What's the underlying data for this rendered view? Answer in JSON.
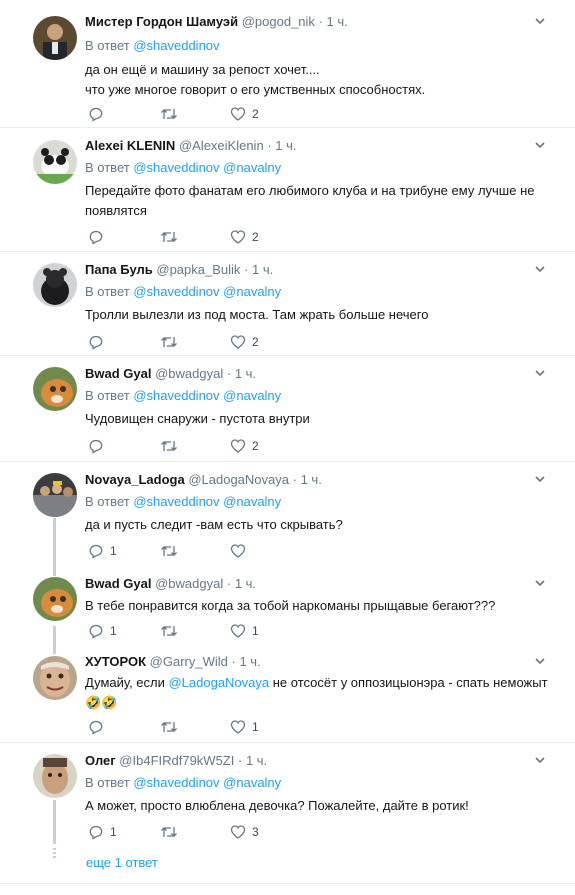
{
  "tweets": [
    {
      "name": "Мистер Гордон Шамуэй",
      "handle": "@pogod_nik",
      "time": "1 ч.",
      "reply_label": "В ответ",
      "reply_to": "@shaveddinov",
      "reply_to2": "",
      "text_line1": "да он ещё и машину за репост хочет....",
      "text_line2": "что уже многое говорит о его умственных способностях.",
      "replies": "",
      "retweets": "",
      "likes": "2"
    },
    {
      "name": "Alexei KLENIN",
      "handle": "@AlexeiKlenin",
      "time": "1 ч.",
      "reply_label": "В ответ",
      "reply_to": "@shaveddinov",
      "reply_to2": "@navalny",
      "text_line1": "Передайте фото фанатам его любимого клуба и на трибуне ему лучше не",
      "text_line2": "появлятся",
      "replies": "",
      "retweets": "",
      "likes": "2"
    },
    {
      "name": "Папа Буль",
      "handle": "@papka_Bulik",
      "time": "1 ч.",
      "reply_label": "В ответ",
      "reply_to": "@shaveddinov",
      "reply_to2": "@navalny",
      "text_line1": "Тролли вылезли из под моста. Там жрать больше нечего",
      "text_line2": "",
      "replies": "",
      "retweets": "",
      "likes": "2"
    },
    {
      "name": "Bwad Gyal",
      "handle": "@bwadgyal",
      "time": "1 ч.",
      "reply_label": "В ответ",
      "reply_to": "@shaveddinov",
      "reply_to2": "@navalny",
      "text_line1": "Чудовищен снаружи - пустота внутри",
      "text_line2": "",
      "replies": "",
      "retweets": "",
      "likes": "2"
    },
    {
      "name": "Novaya_Ladoga",
      "handle": "@LadogaNovaya",
      "time": "1 ч.",
      "reply_label": "В ответ",
      "reply_to": "@shaveddinov",
      "reply_to2": "@navalny",
      "text_line1": "да и пусть следит -вам есть что скрывать?",
      "text_line2": "",
      "replies": "1",
      "retweets": "",
      "likes": ""
    },
    {
      "name": "Bwad Gyal",
      "handle": "@bwadgyal",
      "time": "1 ч.",
      "text_line1": "В тебе понравится когда за тобой наркоманы прыщавые бегают???",
      "replies": "1",
      "retweets": "",
      "likes": "1"
    },
    {
      "name": "ХУТОРОК",
      "handle": "@Garry_Wild",
      "time": "1 ч.",
      "text_pre": "Думайу, если ",
      "text_mention": "@LadogaNovaya",
      "text_post": " не отсосёт у оппозицыонэра - спать неможыт",
      "text_emoji": "🤣🤣",
      "replies": "",
      "retweets": "",
      "likes": "1"
    },
    {
      "name": "Олег",
      "handle": "@Ib4FIRdf79kW5ZI",
      "time": "1 ч.",
      "reply_label": "В ответ",
      "reply_to": "@shaveddinov",
      "reply_to2": "@navalny",
      "text_line1": "А может, просто влюблена девочка? Пожалейте, дайте в ротик!",
      "replies": "1",
      "retweets": "",
      "likes": "3"
    }
  ],
  "more_replies": "еще 1 ответ",
  "dot": "·",
  "colors": {
    "accent": "#1da1f2",
    "muted": "#657786",
    "border": "#e6ecf0"
  }
}
